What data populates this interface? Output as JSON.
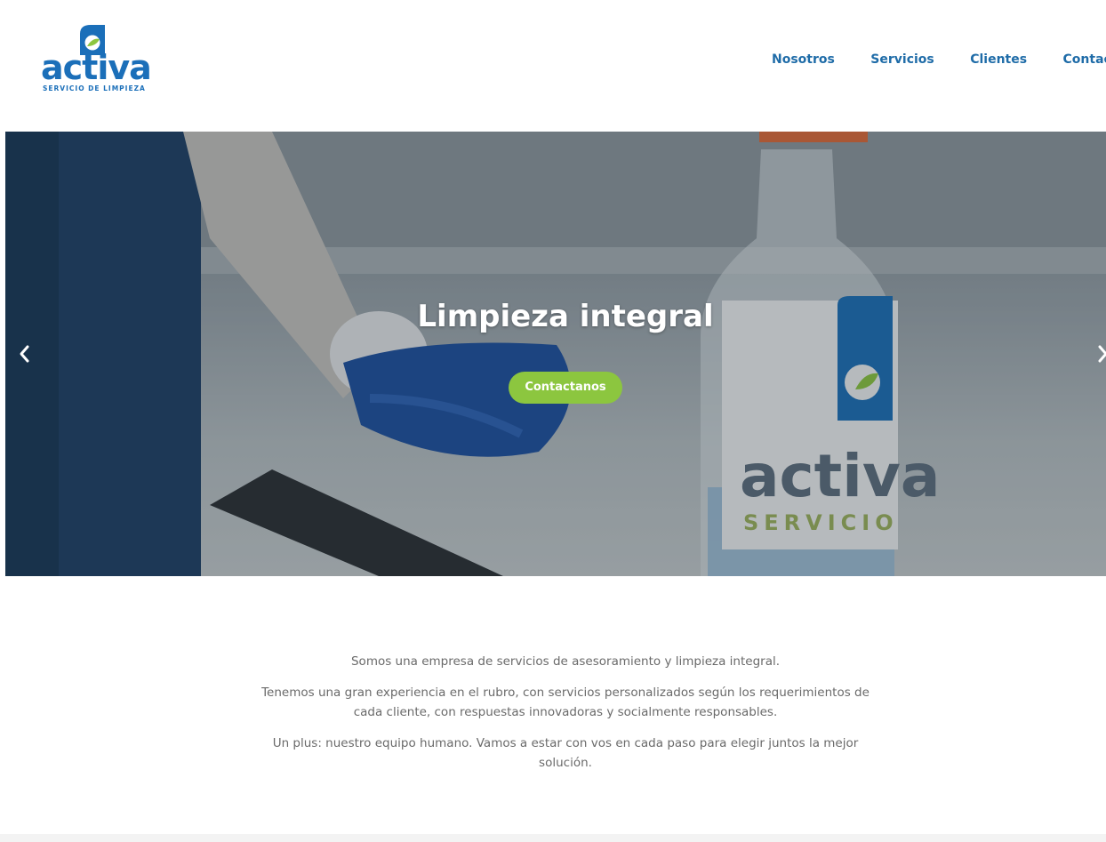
{
  "brand": {
    "name": "activa",
    "tagline": "SERVICIO DE LIMPIEZA",
    "colors": {
      "primary": "#1b6fb9",
      "accent": "#8cc63f"
    }
  },
  "nav": {
    "items": [
      {
        "label": "Nosotros"
      },
      {
        "label": "Servicios"
      },
      {
        "label": "Clientes"
      },
      {
        "label": "Contacto"
      }
    ]
  },
  "hero": {
    "title": "Limpieza integral",
    "cta_label": "Contactanos",
    "bottle_brand": "activa",
    "bottle_sub": "SERVICIO",
    "prev_icon": "chevron-left-icon",
    "next_icon": "chevron-right-icon"
  },
  "intro": {
    "paragraphs": [
      "Somos una empresa de servicios de asesoramiento y limpieza integral.",
      "Tenemos una gran experiencia en el rubro, con servicios personalizados según los requerimientos de cada cliente, con respuestas innovadoras y socialmente responsables.",
      "Un plus: nuestro equipo humano. Vamos a estar con vos en cada paso para elegir juntos la mejor solución."
    ]
  }
}
